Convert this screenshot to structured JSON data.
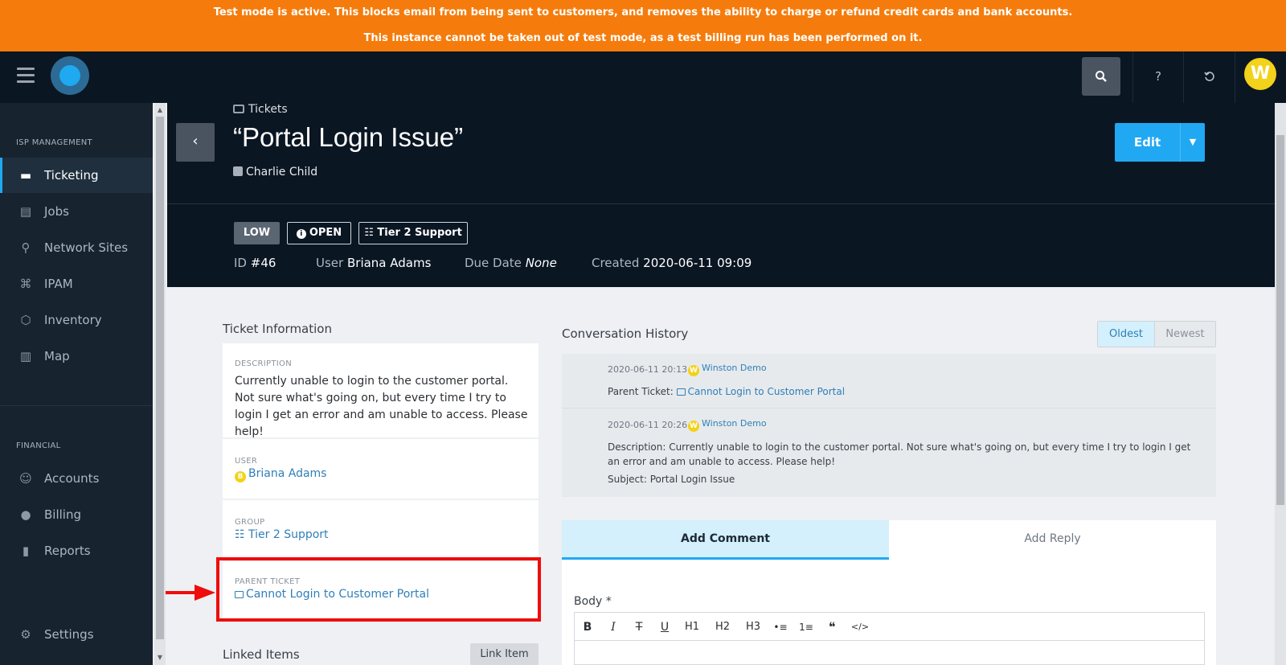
{
  "banner": {
    "line1": "Test mode is active. This blocks email from being sent to customers, and removes the ability to charge or refund credit cards and bank accounts.",
    "line2": "This instance cannot be taken out of test mode, as a test billing run has been performed on it."
  },
  "topbar": {
    "avatar_letter": "W",
    "help_label": "?",
    "icons": [
      "menu-icon",
      "logo",
      "search-icon",
      "help-icon",
      "history-icon",
      "avatar"
    ]
  },
  "sidebar": {
    "section1": "ISP MANAGEMENT",
    "items1": [
      {
        "label": "Ticketing",
        "icon": "ticket-icon",
        "active": true
      },
      {
        "label": "Jobs",
        "icon": "briefcase-icon"
      },
      {
        "label": "Network Sites",
        "icon": "network-icon"
      },
      {
        "label": "IPAM",
        "icon": "ip-icon"
      },
      {
        "label": "Inventory",
        "icon": "box-icon"
      },
      {
        "label": "Map",
        "icon": "map-icon"
      }
    ],
    "section2": "FINANCIAL",
    "items2": [
      {
        "label": "Accounts",
        "icon": "accounts-icon"
      },
      {
        "label": "Billing",
        "icon": "piggy-bank-icon"
      },
      {
        "label": "Reports",
        "icon": "bar-chart-icon"
      }
    ],
    "settings": {
      "label": "Settings",
      "icon": "gear-icon"
    }
  },
  "header": {
    "breadcrumb": "Tickets",
    "title": "“Portal Login Issue”",
    "owner": "Charlie Child",
    "edit_label": "Edit",
    "badges": {
      "priority": "LOW",
      "status": "OPEN",
      "group": "Tier 2 Support"
    },
    "meta": {
      "id_label": "ID",
      "id_value": "#46",
      "user_label": "User",
      "user_value": "Briana Adams",
      "due_label": "Due Date",
      "due_value": "None",
      "created_label": "Created",
      "created_value": "2020-06-11 09:09"
    }
  },
  "ticket_info": {
    "title": "Ticket Information",
    "description_caption": "DESCRIPTION",
    "description": "Currently unable to login to the customer portal. Not sure what's going on, but every time I try to login I get an error and am unable to access. Please help!",
    "user_caption": "USER",
    "user_initial": "B",
    "user": "Briana Adams",
    "group_caption": "GROUP",
    "group": "Tier 2 Support",
    "parent_caption": "PARENT TICKET",
    "parent": "Cannot Login to Customer Portal",
    "linked_title": "Linked Items",
    "link_button": "Link Item"
  },
  "conversation": {
    "title": "Conversation History",
    "sort_oldest": "Oldest",
    "sort_newest": "Newest",
    "entries": [
      {
        "time": "2020-06-11 20:13",
        "user": "Winston Demo",
        "line1_label": "Parent Ticket:",
        "line1_link": "Cannot Login to Customer Portal"
      },
      {
        "time": "2020-06-11 20:26",
        "user": "Winston Demo",
        "line1": "Description:  Currently unable to login to the customer portal. Not sure what's going on, but every time I try to login I get",
        "line2": "an error and am unable to access. Please help!",
        "line3": "Subject: Portal Login Issue"
      }
    ]
  },
  "composer": {
    "tab_comment": "Add Comment",
    "tab_reply": "Add Reply",
    "body_label": "Body *",
    "toolbar": [
      "B",
      "I",
      "T",
      "U",
      "H1",
      "H2",
      "H3",
      "•≡",
      "1≡",
      "❝",
      "</>"
    ]
  },
  "colors": {
    "banner": "#f57c0c",
    "topbar": "#0b1623",
    "accent": "#21a8f2",
    "link": "#2f7fb8",
    "highlight": "#ee0c0c"
  }
}
